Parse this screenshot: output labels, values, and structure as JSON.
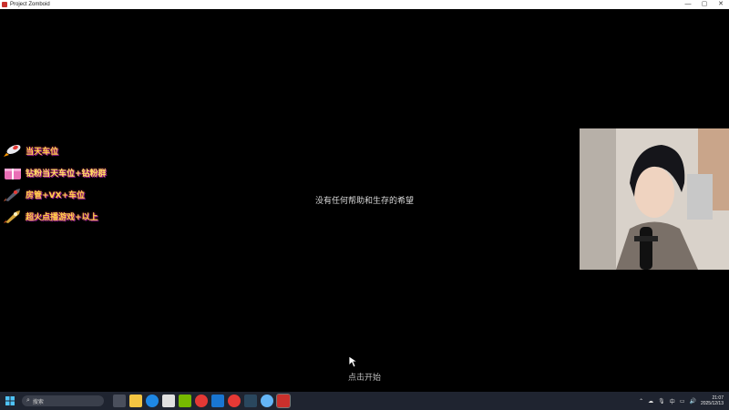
{
  "window": {
    "title": "Project Zomboid",
    "controls": [
      "—",
      "▢",
      "✕"
    ]
  },
  "game": {
    "tagline": "没有任何帮助和生存的希望",
    "start_prompt": "点击开始"
  },
  "overlay": {
    "items": [
      {
        "label": "当天车位",
        "icon": "rocket-icon"
      },
      {
        "label": "钻粉当天车位+钻粉群",
        "icon": "gift-box-icon"
      },
      {
        "label": "房管+VX+车位",
        "icon": "rocket-icon"
      },
      {
        "label": "超火点播游戏+以上",
        "icon": "rocket-icon"
      }
    ]
  },
  "taskbar": {
    "search_placeholder": "搜索",
    "apps": [
      "task-view-icon",
      "file-explorer-icon",
      "edge-icon",
      "store-icon",
      "nvidia-icon",
      "chrome-icon",
      "vscode-icon",
      "netease-icon",
      "steam-icon",
      "app-icon",
      "project-zomboid-icon"
    ],
    "tray": {
      "ime": "中",
      "time": "21:07",
      "date": "2025/12/13"
    }
  }
}
